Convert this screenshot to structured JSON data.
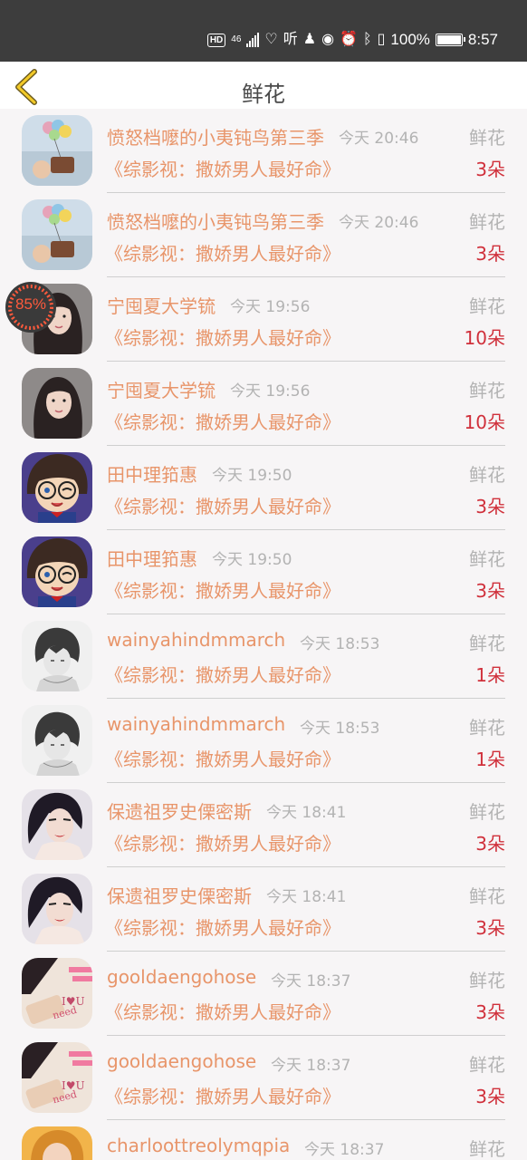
{
  "status_bar": {
    "hd": "HD",
    "network": "46",
    "battery_pct": "100%",
    "time": "8:57",
    "icons": [
      "signal-icon",
      "wifi-icon",
      "listen-icon",
      "qq-icon",
      "eye-icon",
      "alarm-icon",
      "bluetooth-icon",
      "vibrate-icon",
      "battery-icon",
      "charging-icon"
    ]
  },
  "header": {
    "title": "鲜花",
    "back_icon": "chevron-left-icon"
  },
  "floating_badge": {
    "percent": "85%"
  },
  "items": [
    {
      "name": "愤怒档嚒的小夷钝鸟第三季",
      "time": "今天 20:46",
      "type": "鲜花",
      "book": "《综影视：撒娇男人最好命》",
      "count": "3朵",
      "avatar": "balloons"
    },
    {
      "name": "愤怒档嚒的小夷钝鸟第三季",
      "time": "今天 20:46",
      "type": "鲜花",
      "book": "《综影视：撒娇男人最好命》",
      "count": "3朵",
      "avatar": "balloons"
    },
    {
      "name": "宁囤夏大学锍",
      "time": "今天 19:56",
      "type": "鲜花",
      "book": "《综影视：撒娇男人最好命》",
      "count": "10朵",
      "avatar": "girl"
    },
    {
      "name": "宁囤夏大学锍",
      "time": "今天 19:56",
      "type": "鲜花",
      "book": "《综影视：撒娇男人最好命》",
      "count": "10朵",
      "avatar": "girl"
    },
    {
      "name": "田中理筘惠",
      "time": "今天 19:50",
      "type": "鲜花",
      "book": "《综影视：撒娇男人最好命》",
      "count": "3朵",
      "avatar": "conan"
    },
    {
      "name": "田中理筘惠",
      "time": "今天 19:50",
      "type": "鲜花",
      "book": "《综影视：撒娇男人最好命》",
      "count": "3朵",
      "avatar": "conan"
    },
    {
      "name": "wainyahindmmarch",
      "time": "今天 18:53",
      "type": "鲜花",
      "book": "《综影视：撒娇男人最好命》",
      "count": "1朵",
      "avatar": "sketch"
    },
    {
      "name": "wainyahindmmarch",
      "time": "今天 18:53",
      "type": "鲜花",
      "book": "《综影视：撒娇男人最好命》",
      "count": "1朵",
      "avatar": "sketch"
    },
    {
      "name": "保遗祖罗史傈密斯",
      "time": "今天 18:41",
      "type": "鲜花",
      "book": "《综影视：撒娇男人最好命》",
      "count": "3朵",
      "avatar": "woman"
    },
    {
      "name": "保遗祖罗史傈密斯",
      "time": "今天 18:41",
      "type": "鲜花",
      "book": "《综影视：撒娇男人最好命》",
      "count": "3朵",
      "avatar": "woman"
    },
    {
      "name": "gooldaengohose",
      "time": "今天 18:37",
      "type": "鲜花",
      "book": "《综影视：撒娇男人最好命》",
      "count": "3朵",
      "avatar": "hands"
    },
    {
      "name": "gooldaengohose",
      "time": "今天 18:37",
      "type": "鲜花",
      "book": "《综影视：撒娇男人最好命》",
      "count": "3朵",
      "avatar": "hands"
    },
    {
      "name": "charloottreolymqpia",
      "time": "今天 18:37",
      "type": "鲜花",
      "book": "",
      "count": "",
      "avatar": "blonde"
    }
  ]
}
